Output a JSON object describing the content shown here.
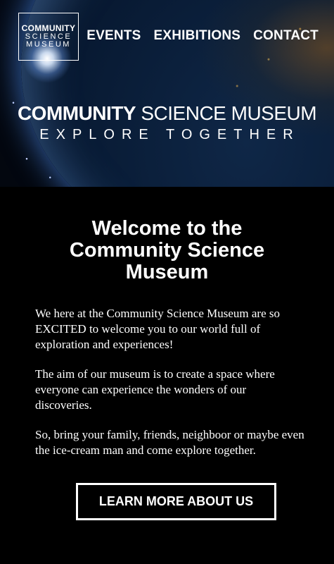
{
  "logo": {
    "line1": "COMMUNITY",
    "line2": "SCIENCE",
    "line3": "MUSEUM"
  },
  "nav": {
    "items": [
      "EVENTS",
      "EXHIBITIONS",
      "CONTACT"
    ]
  },
  "hero": {
    "title_bold": "COMMUNITY",
    "title_rest": " SCIENCE MUSEUM",
    "tagline": "EXPLORE TOGETHER"
  },
  "main": {
    "heading": "Welcome to the Community Science Museum",
    "paragraphs": [
      "We here at the Community Science Museum are so EXCITED to welcome you to our world full of exploration and experiences!",
      "The aim of our museum is to create a space where everyone can experience the wonders of our discoveries.",
      "So, bring your family, friends, neighboor or maybe even the ice-cream man and come explore together."
    ],
    "cta_label": "LEARN MORE ABOUT US"
  }
}
